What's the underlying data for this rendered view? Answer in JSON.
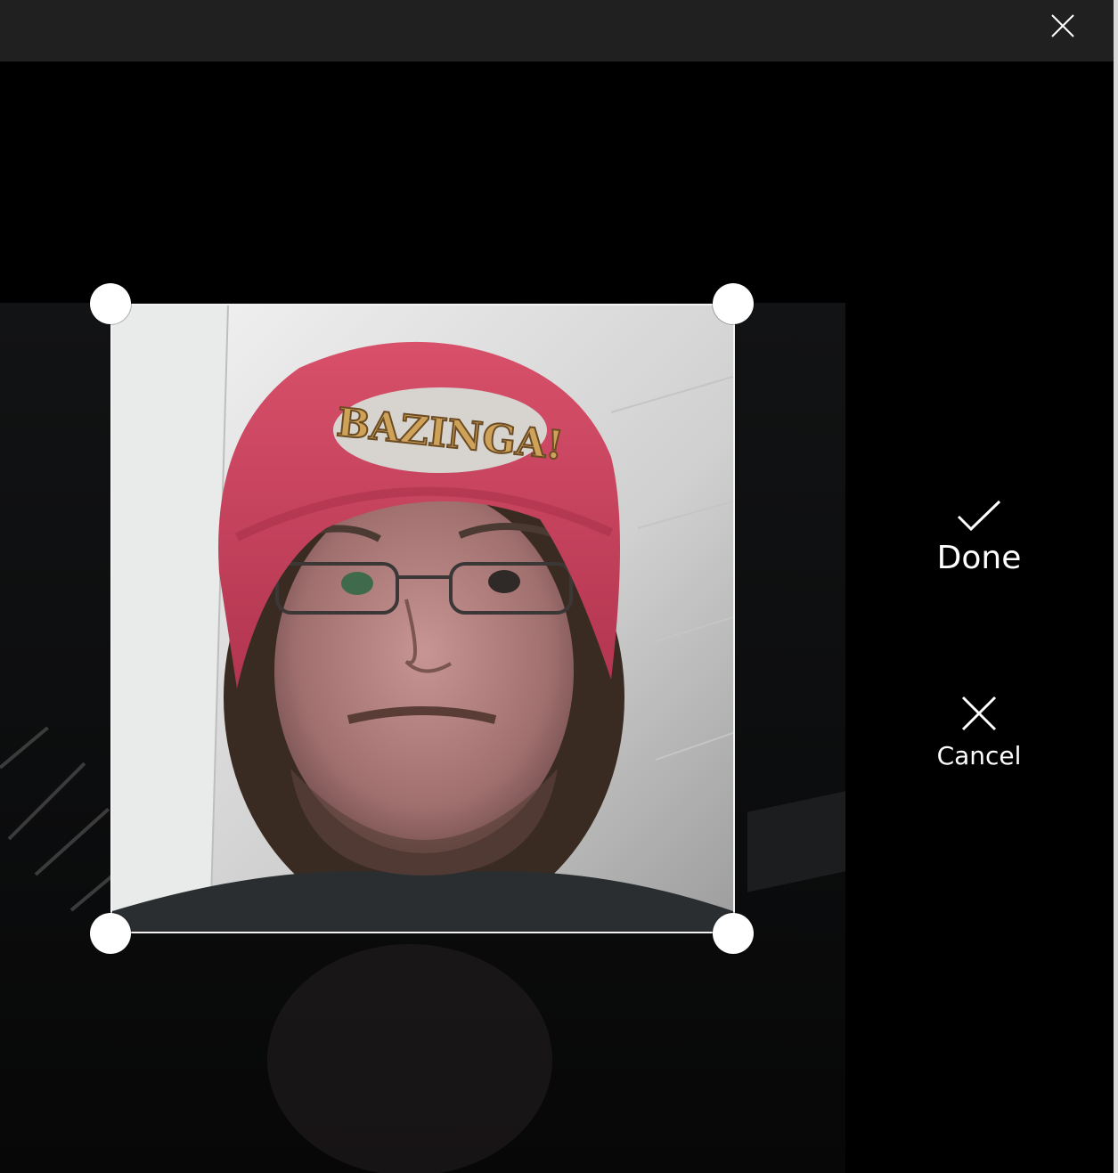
{
  "titlebar": {
    "close_icon": "close-icon"
  },
  "actions": {
    "done_label": "Done",
    "done_icon": "checkmark-icon",
    "cancel_label": "Cancel",
    "cancel_icon": "close-icon"
  },
  "photo": {
    "cap_text": "BAZINGA!",
    "description_icon": "profile-photo"
  },
  "colors": {
    "titlebar": "#202020",
    "background": "#000000",
    "handle": "#ffffff",
    "cap": "#d2445f"
  }
}
